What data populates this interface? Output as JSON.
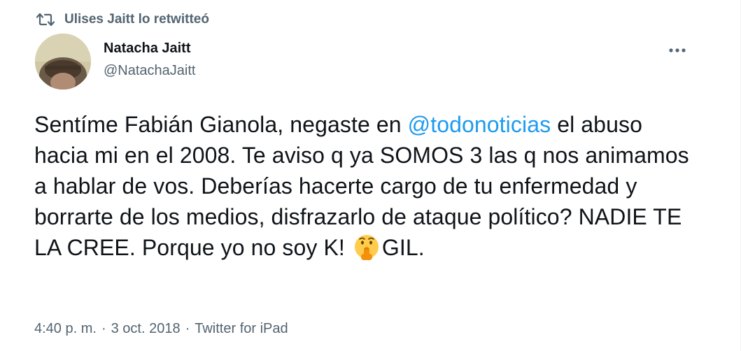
{
  "retweet": {
    "icon": "retweet-icon",
    "label": "Ulises Jaitt lo retwitteó"
  },
  "author": {
    "name": "Natacha Jaitt",
    "handle": "@NatachaJaitt",
    "avatar_icon": "avatar-photo"
  },
  "more_icon": "more-options-icon",
  "tweet": {
    "line1_before": "Sentíme Fabián Gianola, negaste en ",
    "mention": "@todonoticias",
    "line1_after": " el abuso hacia mi en el 2008. Te aviso q ya SOMOS 3 las q nos animamos a hablar de vos. Deberías hacerte cargo de tu enfermedad y borrarte de los medios, disfrazarlo de ataque político? NADIE TE LA CREE. Porque yo no soy K! ",
    "emoji_icon": "shushing-face-emoji",
    "ending": "GIL."
  },
  "meta": {
    "time": "4:40 p. m.",
    "separator": "·",
    "date": "3 oct. 2018",
    "source": "Twitter for iPad"
  },
  "colors": {
    "accent": "#1d9bf0",
    "secondary_text": "#536471",
    "primary_text": "#0f1419"
  }
}
